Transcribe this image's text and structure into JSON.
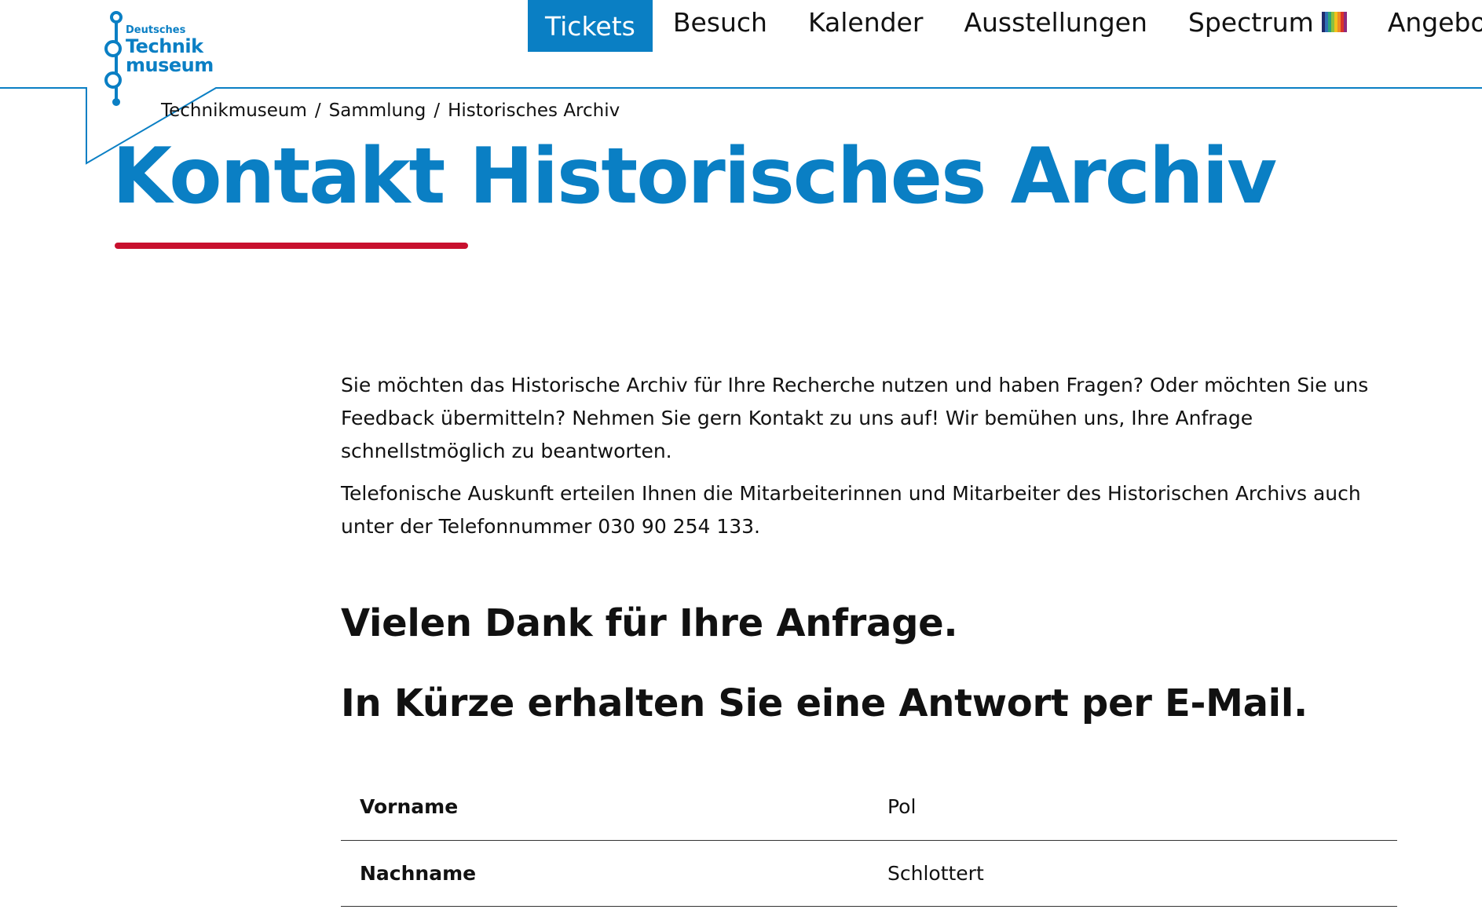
{
  "logo": {
    "line1": "Deutsches",
    "line2": "Technik",
    "line3": "museum"
  },
  "nav": {
    "items": [
      {
        "label": "Tickets"
      },
      {
        "label": "Besuch"
      },
      {
        "label": "Kalender"
      },
      {
        "label": "Ausstellungen"
      },
      {
        "label": "Spectrum"
      },
      {
        "label": "Angebote"
      }
    ]
  },
  "breadcrumb": {
    "items": [
      "Technikmuseum",
      "Sammlung",
      "Historisches Archiv"
    ],
    "separator": "/"
  },
  "page": {
    "title": "Kontakt Historisches Archiv"
  },
  "intro": {
    "paragraph1": "Sie möchten das Historische Archiv für Ihre Recherche nutzen und haben Fragen? Oder möchten Sie uns Feedback übermitteln? Nehmen Sie gern Kontakt zu uns auf! Wir bemühen uns, Ihre Anfrage schnellstmöglich zu beantworten.",
    "paragraph2": "Telefonische Auskunft erteilen Ihnen die Mitarbeiterinnen und Mitarbeiter des Historischen Archivs auch unter der Telefonnummer 030 90 254 133."
  },
  "confirmation": {
    "line1": "Vielen Dank für Ihre Anfrage.",
    "line2": "In Kürze erhalten Sie eine Antwort per E-Mail."
  },
  "result": {
    "rows": [
      {
        "label": "Vorname",
        "value": "Pol"
      },
      {
        "label": "Nachname",
        "value": "Schlottert"
      }
    ]
  },
  "colors": {
    "brand_blue": "#0a7fc4",
    "accent_red": "#c8102e",
    "spectrum": [
      "#1f2a6b",
      "#2f6fb5",
      "#2aa37a",
      "#8cbf3f",
      "#f1c21b",
      "#f08a24",
      "#d9332a",
      "#8e2a7e"
    ]
  }
}
